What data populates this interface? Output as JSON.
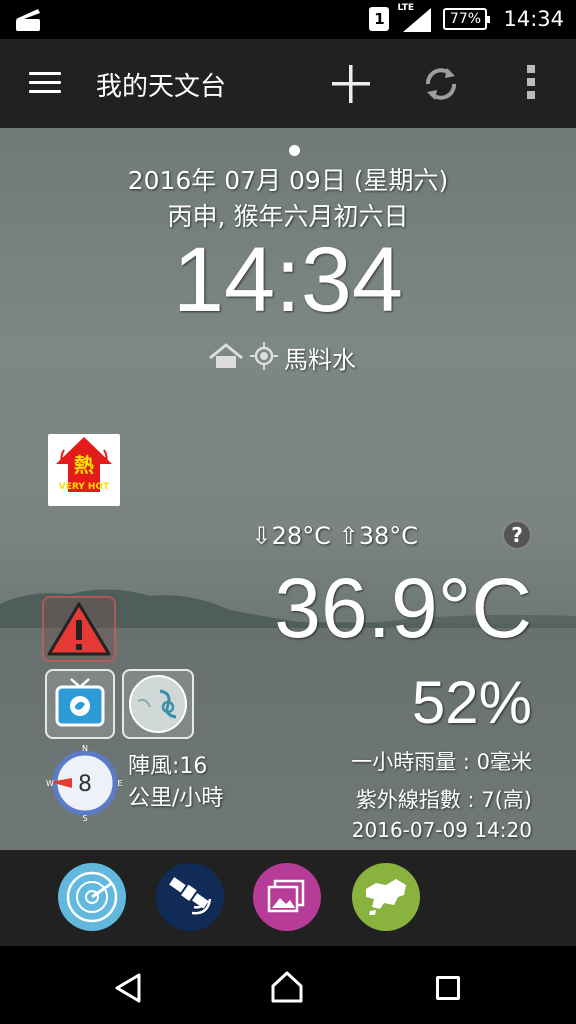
{
  "status_bar": {
    "sim_slot": "1",
    "network": "LTE",
    "battery": "77%",
    "time": "14:34"
  },
  "app_bar": {
    "title": "我的天文台",
    "icons": [
      "menu-icon",
      "add-icon",
      "refresh-icon",
      "overflow-menu-icon"
    ]
  },
  "header": {
    "date": "2016年 07月 09日 (星期六)",
    "lunar_date": "丙申, 猴年六月初六日",
    "time": "14:34",
    "location": "馬料水"
  },
  "warning_badge": {
    "chinese": "熱",
    "english": "VERY HOT"
  },
  "weather": {
    "min_temp": "⇩28°C",
    "max_temp": "⇧38°C",
    "help": "?",
    "temperature": "36.9°C",
    "humidity": "52%",
    "rainfall": "一小時雨量 : 0毫米",
    "uv_index": "紫外線指數 : 7(高)",
    "updated": "2016-07-09 14:20"
  },
  "wind": {
    "gust": "陣風:16",
    "unit": "公里/小時",
    "compass_value": "8",
    "compass_letters": [
      "N",
      "E",
      "S",
      "W"
    ]
  },
  "shortcuts": [
    {
      "name": "radar-icon"
    },
    {
      "name": "satellite-icon"
    },
    {
      "name": "photo-icon"
    },
    {
      "name": "hk-map-icon"
    }
  ],
  "colors": {
    "app_bar": "#212121",
    "warning_red": "#e53935",
    "radar": "#63b8de",
    "satellite": "#0f2b56",
    "photo": "#b73c97",
    "map": "#8ab23f"
  }
}
